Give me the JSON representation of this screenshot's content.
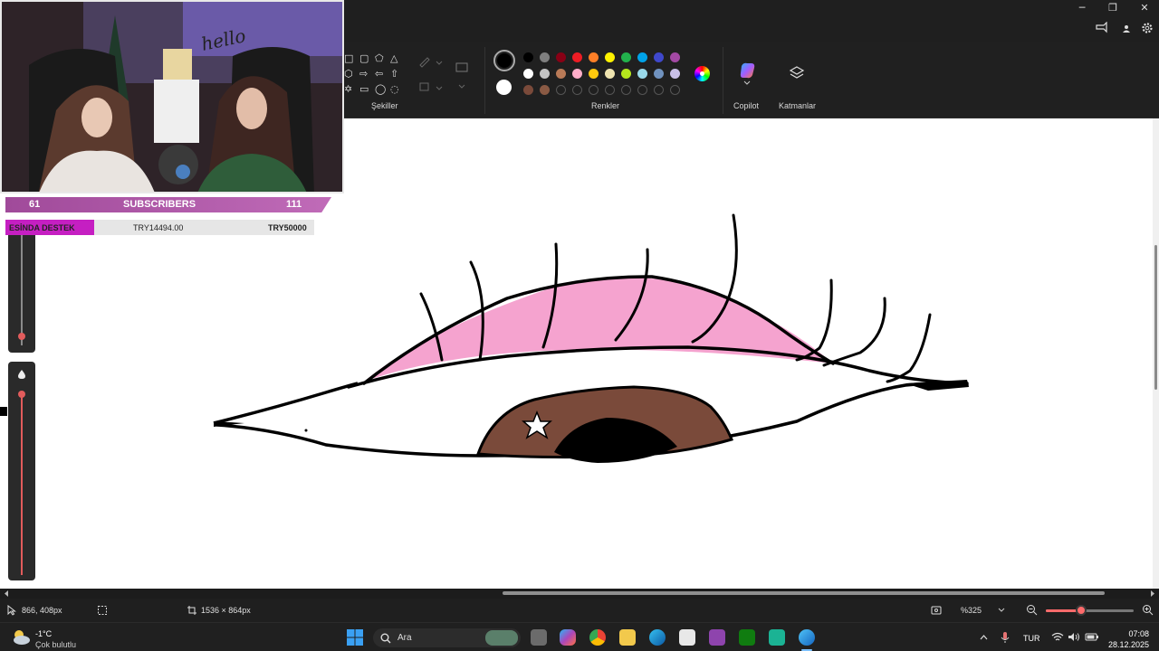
{
  "window": {
    "minimize_glyph": "─",
    "restore_glyph": "❐",
    "close_glyph": "✕"
  },
  "ribbon": {
    "shapes_label": "Şekiller",
    "colors_label": "Renkler",
    "copilot_label": "Copilot",
    "layers_label": "Katmanlar",
    "palette_row1": [
      "#000000",
      "#7f7f7f",
      "#880015",
      "#ed1c24",
      "#ff7f27",
      "#fff200",
      "#22b14c",
      "#00a2e8",
      "#3f48cc",
      "#a349a4"
    ],
    "palette_row2": [
      "#ffffff",
      "#c3c3c3",
      "#b97a57",
      "#ffaec9",
      "#ffc90e",
      "#efe4b0",
      "#b5e61d",
      "#99d9ea",
      "#7092be",
      "#c8bfe7"
    ],
    "palette_row3": [
      "#7a4a3a",
      "#8a5a44"
    ],
    "primary_color": "#000000",
    "secondary_color": "#ffffff"
  },
  "overlay": {
    "sub_left": "61",
    "sub_title": "SUBSCRIBERS",
    "sub_right": "111",
    "donate_label": "ESİNDA DESTEK",
    "donate_current": "TRY14494.00",
    "donate_goal": "TRY50000",
    "sign_text": "hello"
  },
  "status": {
    "cursor_pos": "866, 408px",
    "canvas_size": "1536 × 864px",
    "zoom": "%325",
    "zoom_fraction": 0.4
  },
  "taskbar": {
    "weather_temp": "-1°C",
    "weather_desc": "Çok bulutlu",
    "search_label": "Ara",
    "language": "TUR",
    "time": "07:08",
    "date": "28.12.2025"
  }
}
